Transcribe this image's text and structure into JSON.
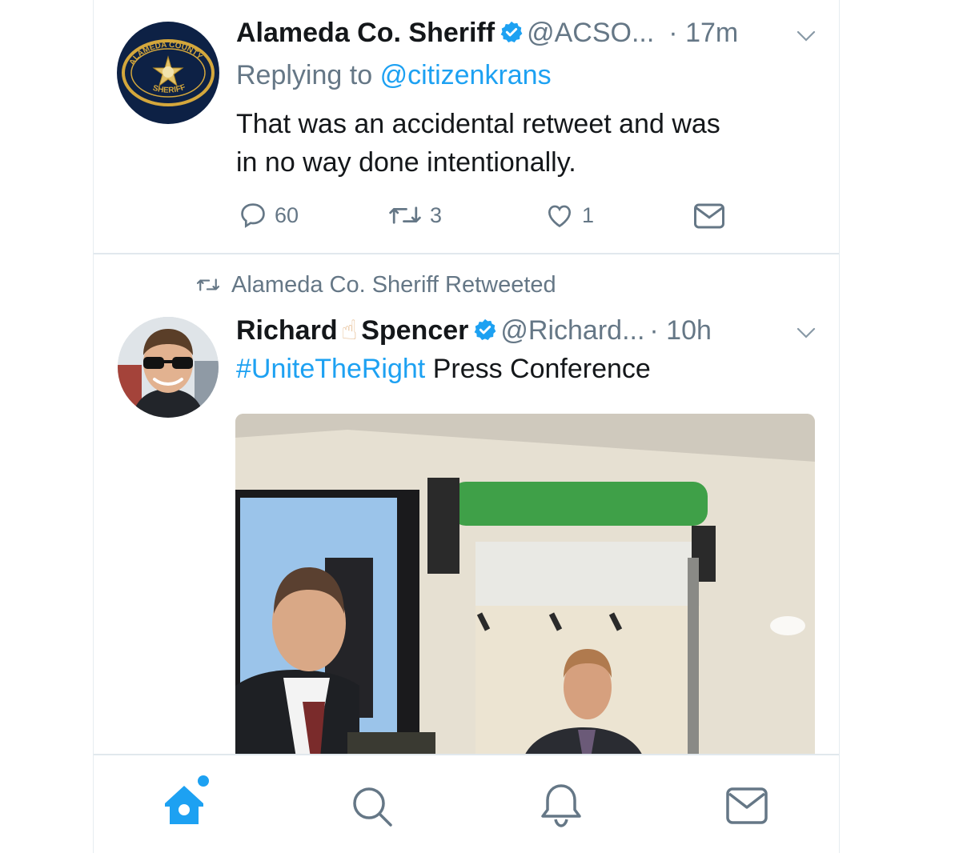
{
  "tweet1": {
    "name": "Alameda Co. Sheriff",
    "handle": "@ACSO...",
    "time": "· 17m",
    "replying_prefix": "Replying to",
    "replying_handle": "@citizenkrans",
    "text_line1": "That was an accidental retweet and was",
    "text_line2": "in no way done intentionally.",
    "replies": "60",
    "retweets": "3",
    "likes": "1",
    "avatar_text_top": "ALAMEDA COUNTY",
    "avatar_text_bottom": "SHERIFF"
  },
  "tweet2": {
    "retweeted_by": "Alameda Co. Sheriff Retweeted",
    "name_first": "Richard",
    "name_emoji": "☝",
    "name_last": "Spencer",
    "handle": "@Richard...",
    "time": "· 10h",
    "hashtag": "#UniteTheRight",
    "text": "Press Conference"
  },
  "colors": {
    "accent": "#1da1f2",
    "muted": "#657786",
    "divider": "#e1e8ed"
  },
  "nav": {
    "icons": [
      "home-icon",
      "search-icon",
      "notifications-icon",
      "messages-icon"
    ]
  }
}
